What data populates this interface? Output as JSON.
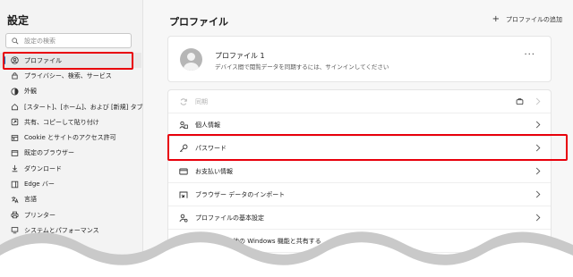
{
  "sidebar": {
    "title": "設定",
    "search_placeholder": "設定の検索",
    "items": [
      {
        "label": "プロファイル",
        "icon": "profile-icon",
        "active": true
      },
      {
        "label": "プライバシー、検索、サービス",
        "icon": "lock-icon"
      },
      {
        "label": "外観",
        "icon": "appearance-icon"
      },
      {
        "label": "[スタート]、[ホーム]、および [新規] タブ",
        "icon": "home-icon"
      },
      {
        "label": "共有、コピーして貼り付け",
        "icon": "share-icon"
      },
      {
        "label": "Cookie とサイトのアクセス許可",
        "icon": "cookie-icon"
      },
      {
        "label": "既定のブラウザー",
        "icon": "browser-icon"
      },
      {
        "label": "ダウンロード",
        "icon": "download-icon"
      },
      {
        "label": "Edge バー",
        "icon": "edge-bar-icon"
      },
      {
        "label": "言語",
        "icon": "language-icon"
      },
      {
        "label": "プリンター",
        "icon": "printer-icon"
      },
      {
        "label": "システムとパフォーマンス",
        "icon": "system-icon"
      }
    ]
  },
  "main": {
    "title": "プロファイル",
    "add_profile": "プロファイルの追加",
    "profile": {
      "name": "プロファイル 1",
      "subtitle": "デバイス間で閲覧データを同期するには、サインインしてください",
      "more": "···"
    },
    "rows": [
      {
        "label": "同期",
        "icon": "sync-icon",
        "disabled": true
      },
      {
        "label": "個人情報",
        "icon": "personal-info-icon"
      },
      {
        "label": "パスワード",
        "icon": "key-icon"
      },
      {
        "label": "お支払い情報",
        "icon": "card-icon"
      },
      {
        "label": "ブラウザー データのインポート",
        "icon": "import-icon"
      },
      {
        "label": "プロファイルの基本設定",
        "icon": "profile-settings-icon"
      },
      {
        "label": "閲覧データを他の Windows 機能と共有する",
        "icon": "windows-icon"
      }
    ]
  },
  "colors": {
    "highlight": "#e8000b",
    "accent": "#0f6cbd"
  }
}
